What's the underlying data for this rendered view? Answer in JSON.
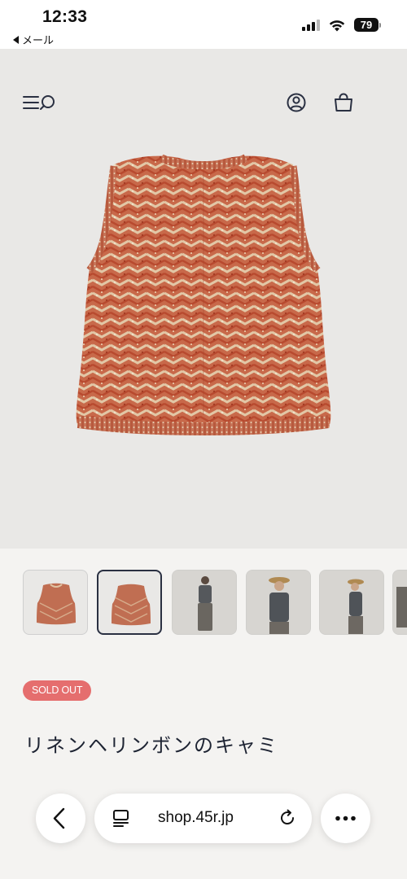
{
  "status_bar": {
    "time": "12:33",
    "back_app": "メール",
    "battery": "79",
    "signal_icon": "cellular-signal-icon",
    "wifi_icon": "wifi-icon",
    "battery_icon": "battery-icon"
  },
  "header": {
    "menu_icon": "hamburger-menu-icon",
    "search_icon": "search-icon",
    "account_icon": "user-account-icon",
    "cart_icon": "shopping-bag-icon"
  },
  "product": {
    "main_image": "herringbone-knit-vest",
    "badge": "SOLD OUT",
    "badge_color": "#e56e6e",
    "title": "リネンヘリンボンのキャミ",
    "title_color": "#1e2433",
    "thumbnails": [
      {
        "subject": "vest-flat-front",
        "selected": false
      },
      {
        "subject": "vest-flat-back",
        "selected": true
      },
      {
        "subject": "model-front-full",
        "selected": false
      },
      {
        "subject": "model-front-closeup",
        "selected": false
      },
      {
        "subject": "model-side",
        "selected": false
      },
      {
        "subject": "model-partial",
        "selected": false
      }
    ]
  },
  "browser": {
    "url": "shop.45r.jp",
    "back_icon": "chevron-left-icon",
    "tabs_icon": "tab-overview-icon",
    "reload_icon": "reload-icon",
    "more_icon": "more-dots-icon"
  },
  "colors": {
    "hero_background": "#e9e8e6",
    "page_background": "#f4f3f1",
    "accent_navy": "#2a3042"
  }
}
